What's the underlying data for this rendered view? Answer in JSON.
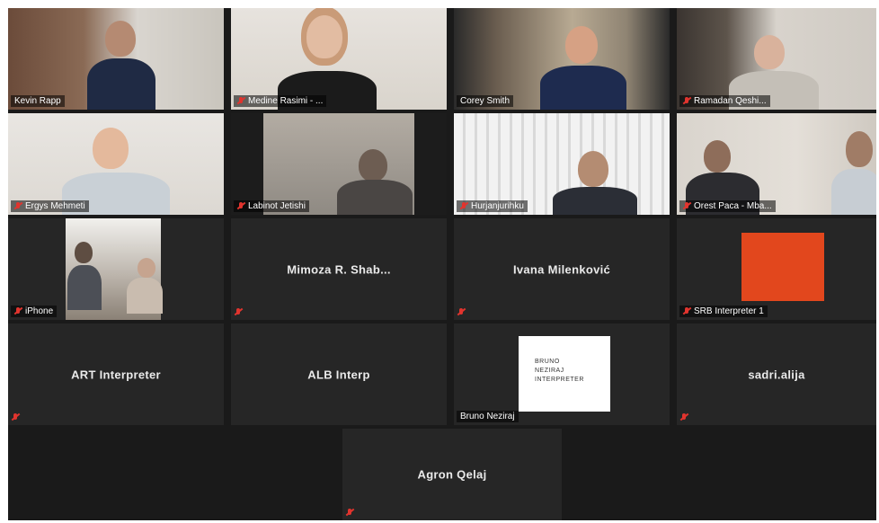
{
  "meeting": {
    "rows": [
      [
        {
          "type": "video",
          "name": "Kevin Rapp",
          "muted": false,
          "scene": "office-left"
        },
        {
          "type": "video",
          "name": "Medine Rasimi - ...",
          "muted": true,
          "scene": "woman"
        },
        {
          "type": "video",
          "name": "Corey Smith",
          "muted": false,
          "active_speaker": true,
          "scene": "man-suit"
        },
        {
          "type": "video",
          "name": "Ramadan Qeshi...",
          "muted": true,
          "scene": "man-bald"
        }
      ],
      [
        {
          "type": "video",
          "name": "Ergys Mehmeti",
          "muted": true,
          "scene": "man-young"
        },
        {
          "type": "video",
          "name": "Labinot Jetishi",
          "muted": true,
          "scene": "man-dark"
        },
        {
          "type": "video",
          "name": "Hurjanjurihku",
          "muted": true,
          "scene": "man-blinds"
        },
        {
          "type": "video",
          "name": "Orest Paca - Mba...",
          "muted": true,
          "scene": "two-men"
        }
      ],
      [
        {
          "type": "video",
          "name": "iPhone",
          "muted": true,
          "scene": "small-room"
        },
        {
          "type": "name",
          "name": "Mimoza R. Shab...",
          "muted": true
        },
        {
          "type": "name",
          "name": "Ivana Milenković",
          "muted": true
        },
        {
          "type": "image",
          "name": "SRB Interpreter 1",
          "muted": true,
          "image": "orange-square"
        }
      ],
      [
        {
          "type": "name",
          "name": "ART Interpreter",
          "muted": true
        },
        {
          "type": "name",
          "name": "ALB Interp",
          "muted": true
        },
        {
          "type": "image",
          "name": "Bruno Neziraj",
          "muted": false,
          "image": "logo",
          "logo_lines": [
            "BRUNO",
            "NEZIRAJ",
            "INTERPRETER"
          ]
        },
        {
          "type": "name",
          "name": "sadri.alija",
          "muted": true
        }
      ],
      [
        {
          "type": "name",
          "name": "Agron Qelaj",
          "muted": true
        }
      ]
    ]
  },
  "colors": {
    "background": "#1a1a1a",
    "tile": "#262626",
    "active_speaker_border": "#c9cf3a",
    "muted_icon": "#e1342e"
  },
  "icons": {
    "muted": "mic-muted-icon"
  }
}
